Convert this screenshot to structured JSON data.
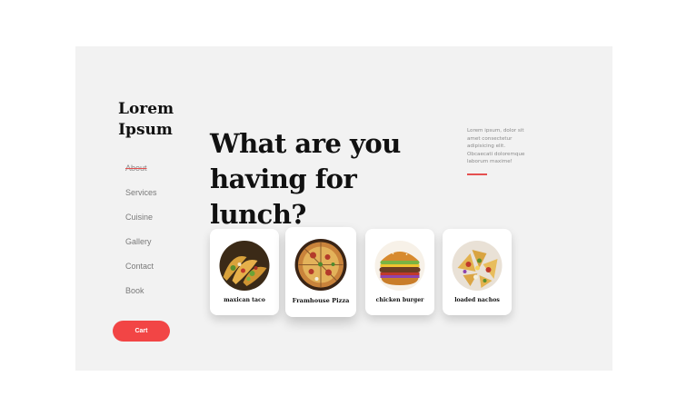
{
  "brand": {
    "line1": "Lorem",
    "line2": "Ipsum"
  },
  "nav": {
    "items": [
      {
        "label": "About",
        "active": true
      },
      {
        "label": "Services"
      },
      {
        "label": "Cuisine"
      },
      {
        "label": "Gallery"
      },
      {
        "label": "Contact"
      },
      {
        "label": "Book"
      }
    ]
  },
  "cart": {
    "label": "Cart"
  },
  "hero": {
    "line1": "What are you",
    "line2": "having for lunch?"
  },
  "blurb": {
    "text": "Lorem ipsum, dolor sit amet consectetur adipisicing elit. Obcaecati doloremque laborum maxime!"
  },
  "cards": [
    {
      "label": "maxican taco",
      "icon": "taco-photo"
    },
    {
      "label": "Framhouse Pizza",
      "icon": "pizza-photo"
    },
    {
      "label": "chicken burger",
      "icon": "burger-photo"
    },
    {
      "label": "loaded nachos",
      "icon": "nachos-photo"
    }
  ],
  "colors": {
    "accent": "#f24545",
    "panel": "#f2f2f2",
    "underline": "#e55050"
  }
}
